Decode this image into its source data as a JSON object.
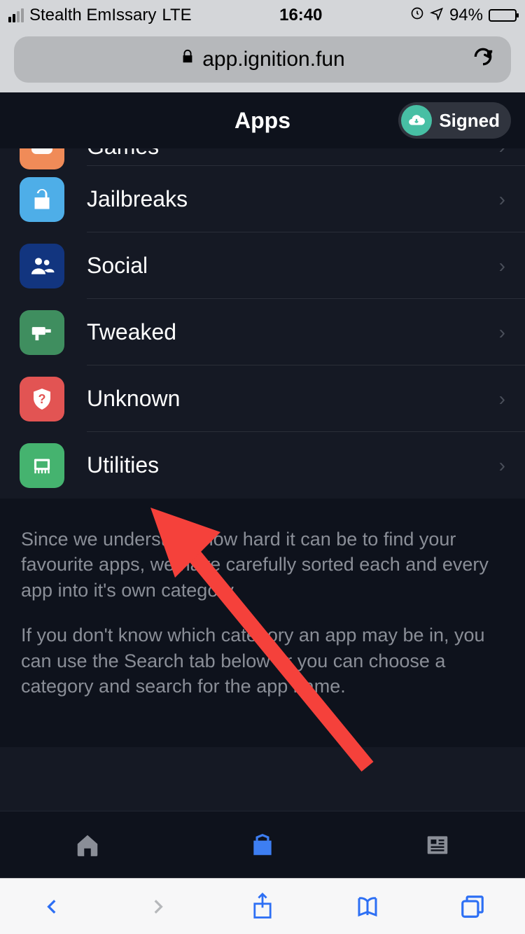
{
  "status_bar": {
    "carrier": "Stealth EmIssary",
    "network": "LTE",
    "time": "16:40",
    "battery_pct": "94%"
  },
  "safari": {
    "url_display": "app.ignition.fun"
  },
  "header": {
    "title": "Apps",
    "badge": "Signed"
  },
  "categories": [
    {
      "label": "Games",
      "icon_bg": "#f08b58",
      "icon": "gamepad"
    },
    {
      "label": "Jailbreaks",
      "icon_bg": "#4eaee8",
      "icon": "unlock"
    },
    {
      "label": "Social",
      "icon_bg": "#12357f",
      "icon": "users"
    },
    {
      "label": "Tweaked",
      "icon_bg": "#3f8e5f",
      "icon": "drill"
    },
    {
      "label": "Unknown",
      "icon_bg": "#e25453",
      "icon": "shield-q"
    },
    {
      "label": "Utilities",
      "icon_bg": "#45b36f",
      "icon": "chip"
    }
  ],
  "footer": {
    "p1": "Since we understand how hard it can be to find your favourite apps, we have carefully sorted each and every app into it's own category.",
    "p2": "If you don't know which category an app may be in, you can use the Search tab below or you can choose a category and search for the app name."
  }
}
